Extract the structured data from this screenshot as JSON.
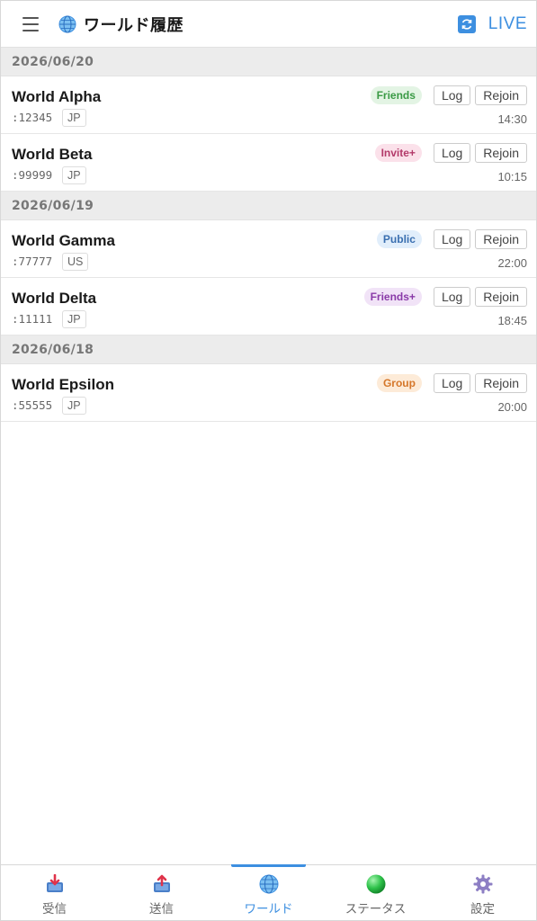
{
  "header": {
    "title": "ワールド履歴",
    "live_label": "LIVE",
    "menu_icon": "hamburger-icon",
    "title_icon": "globe-icon",
    "refresh_icon": "refresh-icon"
  },
  "colors": {
    "accent": "#3d8fe0",
    "date_header_bg": "#ececec"
  },
  "groups": [
    {
      "date": "2026/06/20",
      "items": [
        {
          "name": "World Alpha",
          "id": ":12345",
          "region": "JP",
          "time": "14:30",
          "badge": "Friends",
          "badge_bg": "#e3f4e4",
          "badge_color": "#3a9a45"
        },
        {
          "name": "World Beta",
          "id": ":99999",
          "region": "JP",
          "time": "10:15",
          "badge": "Invite+",
          "badge_bg": "#fbe1ea",
          "badge_color": "#b33a6a"
        }
      ]
    },
    {
      "date": "2026/06/19",
      "items": [
        {
          "name": "World Gamma",
          "id": ":77777",
          "region": "US",
          "time": "22:00",
          "badge": "Public",
          "badge_bg": "#e1eefb",
          "badge_color": "#3a6fb0"
        },
        {
          "name": "World Delta",
          "id": ":11111",
          "region": "JP",
          "time": "18:45",
          "badge": "Friends+",
          "badge_bg": "#f1e3f7",
          "badge_color": "#8a3aa8"
        }
      ]
    },
    {
      "date": "2026/06/18",
      "items": [
        {
          "name": "World Epsilon",
          "id": ":55555",
          "region": "JP",
          "time": "20:00",
          "badge": "Group",
          "badge_bg": "#fdebd8",
          "badge_color": "#d5772a"
        }
      ]
    }
  ],
  "buttons": {
    "log": "Log",
    "rejoin": "Rejoin"
  },
  "nav": [
    {
      "label": "受信",
      "icon": "inbox-download-icon"
    },
    {
      "label": "送信",
      "icon": "outbox-upload-icon"
    },
    {
      "label": "ワールド",
      "icon": "globe-icon",
      "active": true
    },
    {
      "label": "ステータス",
      "icon": "green-status-orb-icon"
    },
    {
      "label": "設定",
      "icon": "gear-icon"
    }
  ]
}
